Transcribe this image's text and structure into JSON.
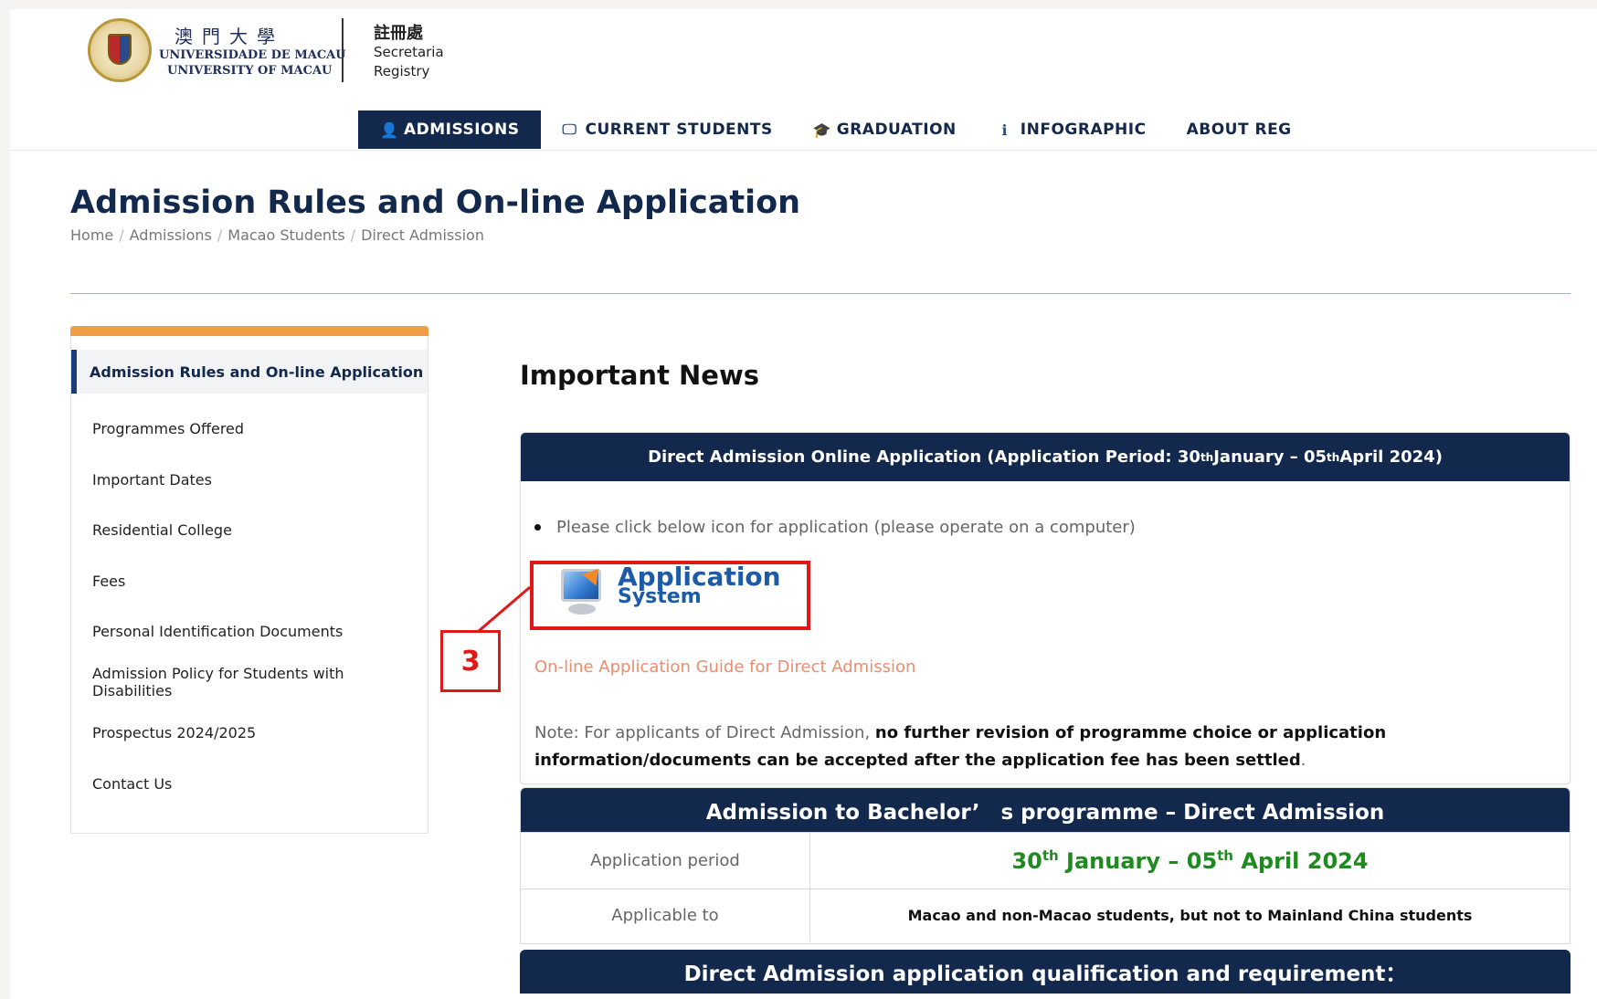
{
  "header": {
    "uni_cn": "澳門大學",
    "uni_pt": "UNIVERSIDADE DE MACAU",
    "uni_en": "UNIVERSITY OF MACAU",
    "registry_cn": "註冊處",
    "registry_pt": "Secretaria",
    "registry_en": "Registry"
  },
  "nav": {
    "items": [
      {
        "label": "ADMISSIONS",
        "icon": "user-icon",
        "glyph": "👤",
        "active": true
      },
      {
        "label": "CURRENT STUDENTS",
        "icon": "presentation-icon",
        "glyph": "🖵",
        "active": false
      },
      {
        "label": "GRADUATION",
        "icon": "graduate-icon",
        "glyph": "🎓",
        "active": false
      },
      {
        "label": "INFOGRAPHIC",
        "icon": "info-icon",
        "glyph": "ℹ",
        "active": false
      },
      {
        "label": "ABOUT REG",
        "icon": "",
        "glyph": "",
        "active": false
      }
    ]
  },
  "page": {
    "title": "Admission Rules and On-line Application",
    "breadcrumb": [
      "Home",
      "Admissions",
      "Macao Students",
      "Direct Admission"
    ]
  },
  "sidebar": {
    "active": "Admission Rules and On-line Application",
    "items": [
      "Programmes Offered",
      "Important Dates",
      "Residential College",
      "Fees",
      "Personal Identification Documents",
      "Admission Policy for Students with Disabilities",
      "Prospectus 2024/2025",
      "Contact Us"
    ]
  },
  "news": {
    "title": "Important News",
    "card1": {
      "head_a": "Direct Admission Online Application (Application Period: 30",
      "head_sup1": "th",
      "head_b": " January – 05",
      "head_sup2": "th",
      "head_c": " April 2024)",
      "bullet": "Please click below icon for application (please operate on a computer)",
      "app_line1": "Application",
      "app_line2": "System",
      "guide": "On-line Application Guide for Direct Admission",
      "note_a": "Note: For applicants of Direct Admission, ",
      "note_b": "no further revision of programme choice or application information/documents can be accepted after the application fee has been settled",
      "note_c": "."
    },
    "card2": {
      "head": "Admission to Bachelor’　s programme – Direct Admission",
      "period_label": "Application period",
      "period_a": "30",
      "period_sup1": "th",
      "period_b": " January – 05",
      "period_sup2": "th",
      "period_c": " April 2024",
      "applicable_label": "Applicable to",
      "applicable_value": "Macao and non-Macao students, but not to Mainland China students"
    },
    "card3": {
      "head": "Direct Admission application qualification and requirement："
    }
  },
  "annotation": {
    "step": "3",
    "color": "#e01818"
  },
  "colors": {
    "navy": "#12294d",
    "orange": "#ef9e46",
    "green": "#1f8a1f",
    "link": "#ee8c6c"
  }
}
